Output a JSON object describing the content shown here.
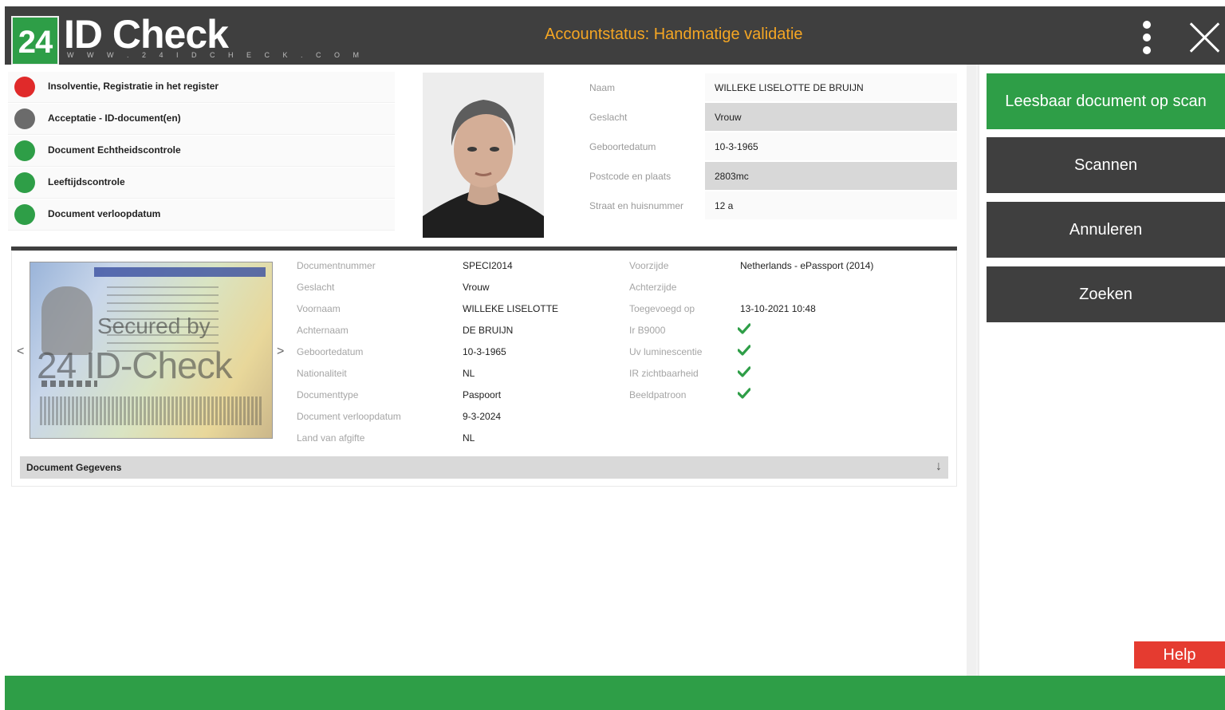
{
  "header": {
    "logo_number": "24",
    "logo_name": "ID Check",
    "logo_url": "W W W . 2 4 I D C H E C K . C O M",
    "account_status": "Accountstatus: Handmatige validatie"
  },
  "checks": [
    {
      "label": "Insolventie, Registratie in het register",
      "status_color": "#e02a2a"
    },
    {
      "label": "Acceptatie - ID-document(en)",
      "status_color": "#6b6b6b"
    },
    {
      "label": "Document Echtheidscontrole",
      "status_color": "#2e9e47"
    },
    {
      "label": "Leeftijdscontrole",
      "status_color": "#2e9e47"
    },
    {
      "label": "Document verloopdatum",
      "status_color": "#2e9e47"
    }
  ],
  "person": {
    "rows": [
      {
        "label": "Naam",
        "value": "WILLEKE LISELOTTE DE BRUIJN"
      },
      {
        "label": "Geslacht",
        "value": "Vrouw"
      },
      {
        "label": "Geboortedatum",
        "value": "10-3-1965"
      },
      {
        "label": "Postcode en plaats",
        "value": "2803mc"
      },
      {
        "label": "Straat en huisnummer",
        "value": "12 a"
      }
    ]
  },
  "document": {
    "prev_arrow": "<",
    "next_arrow": ">",
    "watermark_line1": "Secured by",
    "watermark_line2": "24 ID-Check",
    "fields": [
      {
        "label": "Documentnummer",
        "value": "SPECI2014"
      },
      {
        "label": "Geslacht",
        "value": "Vrouw"
      },
      {
        "label": "Voornaam",
        "value": "WILLEKE LISELOTTE"
      },
      {
        "label": "Achternaam",
        "value": "DE BRUIJN"
      },
      {
        "label": "Geboortedatum",
        "value": "10-3-1965"
      },
      {
        "label": "Nationaliteit",
        "value": "NL"
      },
      {
        "label": "Documenttype",
        "value": "Paspoort"
      },
      {
        "label": "Document verloopdatum",
        "value": "9-3-2024"
      },
      {
        "label": "Land van afgifte",
        "value": "NL"
      }
    ],
    "details": [
      {
        "label": "Voorzijde",
        "value": "Netherlands - ePassport (2014)"
      },
      {
        "label": "Achterzijde",
        "value": ""
      },
      {
        "label": "Toegevoegd op",
        "value": "13-10-2021 10:48"
      },
      {
        "label": "Ir B9000",
        "check": true
      },
      {
        "label": "Uv luminescentie",
        "check": true
      },
      {
        "label": "IR zichtbaarheid",
        "check": true
      },
      {
        "label": "Beeldpatroon",
        "check": true
      }
    ],
    "section_label": "Document Gegevens",
    "section_arrow": "↓"
  },
  "actions": {
    "readable_scan": "Leesbaar document op scan",
    "scan": "Scannen",
    "cancel": "Annuleren",
    "search": "Zoeken",
    "help": "Help"
  },
  "colors": {
    "accent_green": "#2e9e47",
    "header_dark": "#3f3f3f",
    "status_orange": "#f5a623",
    "help_red": "#e53b30"
  }
}
